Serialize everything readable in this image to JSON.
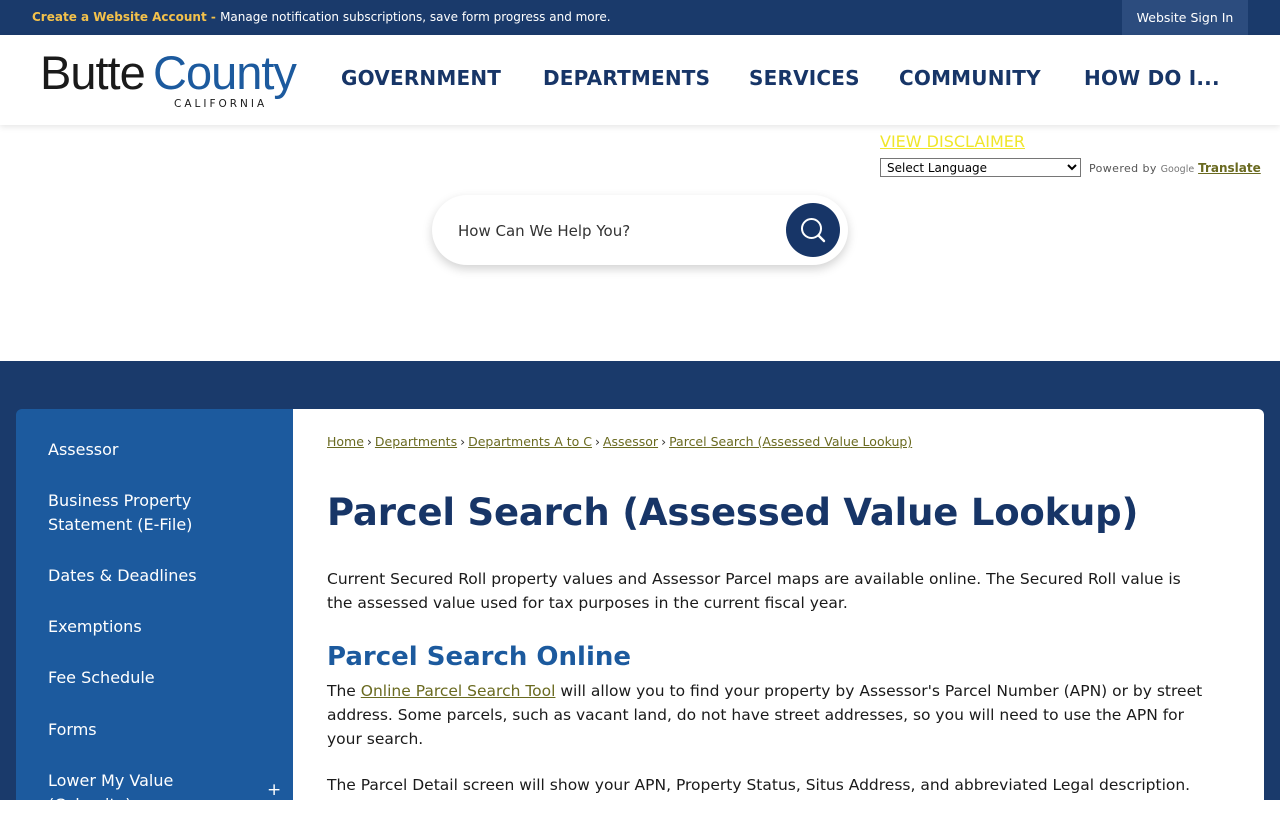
{
  "topbar": {
    "create_account": "Create a Website Account",
    "separator": " - ",
    "message": "Manage notification subscriptions, save form progress and more.",
    "sign_in": "Website Sign In"
  },
  "logo": {
    "name_part1": "Butte",
    "name_part2": "County",
    "state": "CALIFORNIA"
  },
  "nav": {
    "items": [
      {
        "label": "GOVERNMENT"
      },
      {
        "label": "DEPARTMENTS"
      },
      {
        "label": "SERVICES"
      },
      {
        "label": "COMMUNITY"
      },
      {
        "label": "HOW DO I..."
      }
    ]
  },
  "translate": {
    "disclaimer": "VIEW DISCLAIMER",
    "select_value": "Select Language",
    "powered_by": "Powered by",
    "google": "Google",
    "translate_label": "Translate"
  },
  "search": {
    "placeholder": "How Can We Help You?"
  },
  "sidebar": {
    "items": [
      {
        "label": "Assessor"
      },
      {
        "label": "Business Property Statement (E-File)"
      },
      {
        "label": "Dates & Deadlines"
      },
      {
        "label": "Exemptions"
      },
      {
        "label": "Fee Schedule"
      },
      {
        "label": "Forms"
      },
      {
        "label": "Lower My Value (Calamity)"
      }
    ],
    "expand_symbol": "+"
  },
  "breadcrumb": {
    "items": [
      {
        "label": "Home"
      },
      {
        "label": "Departments"
      },
      {
        "label": "Departments A to C"
      },
      {
        "label": "Assessor"
      },
      {
        "label": "Parcel Search (Assessed Value Lookup)"
      }
    ],
    "separator": "›"
  },
  "main": {
    "title": "Parcel Search (Assessed Value Lookup)",
    "intro": "Current Secured Roll property values and Assessor Parcel maps are available online. The Secured Roll value is the assessed value used for tax purposes in the current fiscal year.",
    "section_title": "Parcel Search Online",
    "para2_prefix": "The ",
    "para2_link": "Online Parcel Search Tool",
    "para2_suffix": " will allow you to find your property by Assessor's Parcel Number (APN) or by street address. Some parcels, such as vacant land, do not have street addresses, so you will need to use the APN for your search.",
    "para3": "The Parcel Detail screen will show your APN, Property Status, Situs Address, and abbreviated Legal description. The"
  },
  "colors": {
    "navy": "#1a3a6b",
    "nav_text": "#173567",
    "sidebar_blue": "#1c5a9e",
    "link_olive": "#6a6a20",
    "accent_yellow": "#f3c14b"
  }
}
